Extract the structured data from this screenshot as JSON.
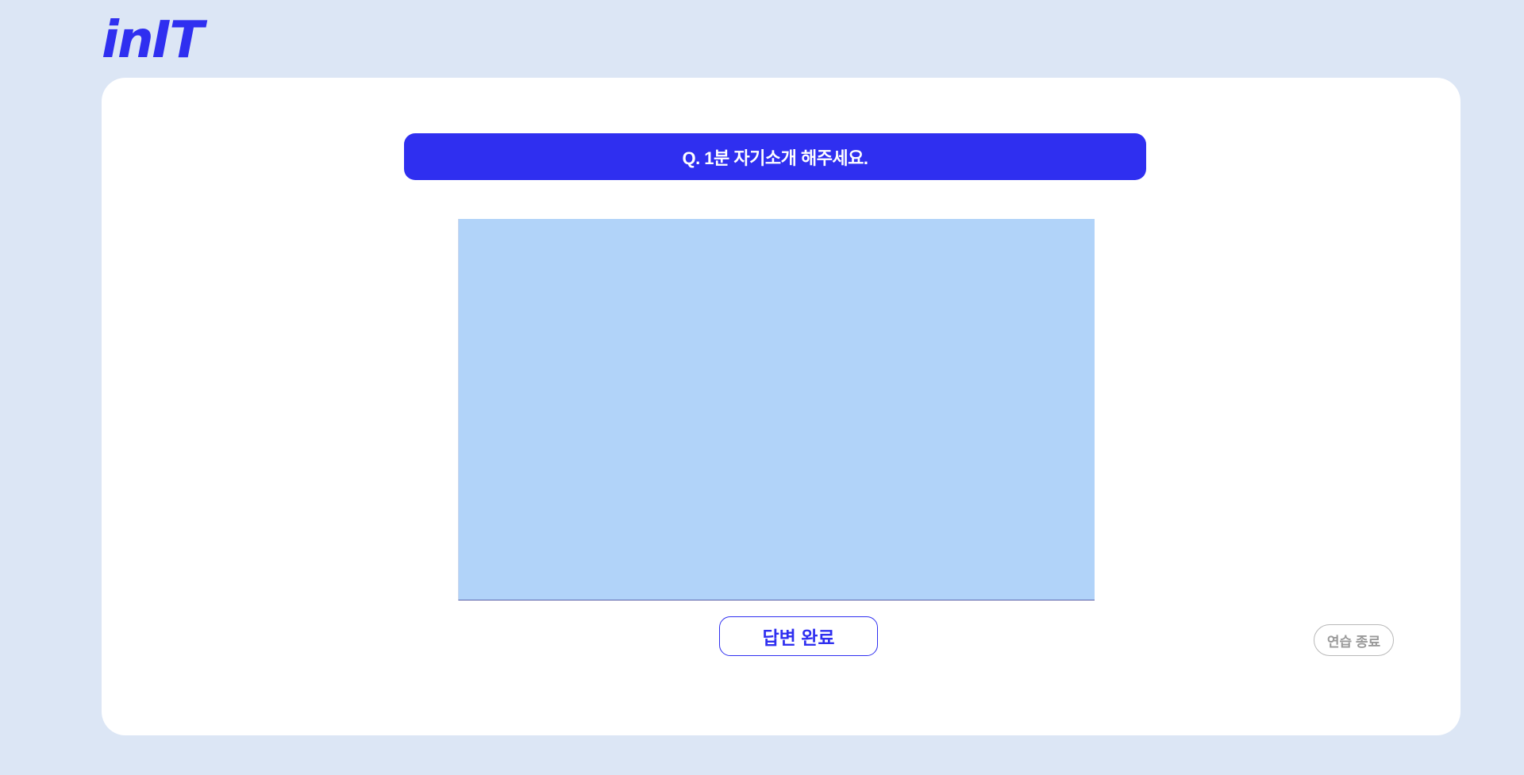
{
  "app": {
    "logo_text": "inIT"
  },
  "question": {
    "text": "Q. 1분 자기소개 해주세요."
  },
  "video": {
    "icon": "camera-preview"
  },
  "actions": {
    "done_label": "답변 완료",
    "end_label": "연습 종료"
  },
  "colors": {
    "brand": "#2f2ff0",
    "background": "#dce6f5",
    "card": "#ffffff",
    "video_placeholder": "#b1d3f9",
    "muted": "#9a9a9a"
  }
}
